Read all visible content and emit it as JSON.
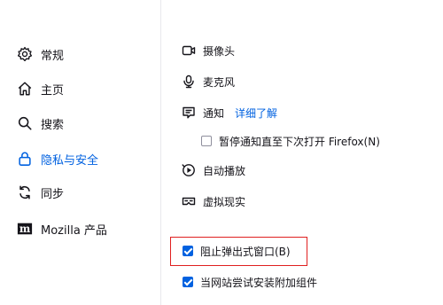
{
  "sidebar": {
    "items": [
      {
        "label": "常规",
        "icon": "gear-icon",
        "active": false
      },
      {
        "label": "主页",
        "icon": "home-icon",
        "active": false
      },
      {
        "label": "搜索",
        "icon": "search-icon",
        "active": false
      },
      {
        "label": "隐私与安全",
        "icon": "lock-icon",
        "active": true
      },
      {
        "label": "同步",
        "icon": "sync-icon",
        "active": false
      },
      {
        "label": "Mozilla 产品",
        "icon": "mozilla-logo-icon",
        "active": false
      }
    ]
  },
  "permissions": {
    "camera": "摄像头",
    "microphone": "麦克风",
    "notifications": "通知",
    "learn_more": "详细了解",
    "pause_notifications": "暂停通知直至下次打开 Firefox(N)",
    "autoplay": "自动播放",
    "virtual_reality": "虚拟现实"
  },
  "popups": {
    "block_popups": "阻止弹出式窗口(B)",
    "warn_addons": "当网站尝试安装附加组件"
  },
  "colors": {
    "accent": "#0061e0",
    "highlight": "#e02020"
  }
}
